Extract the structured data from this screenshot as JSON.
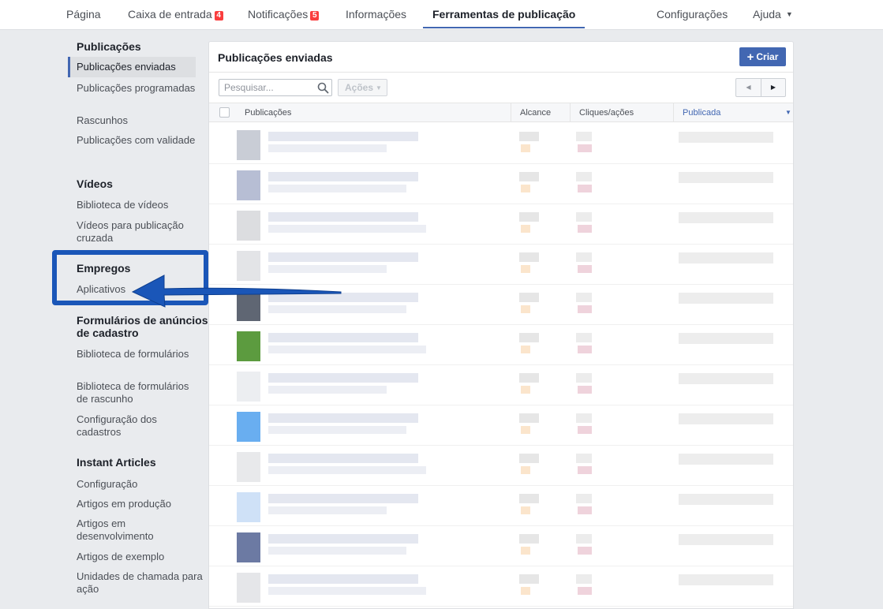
{
  "topnav": {
    "tabs": [
      {
        "label": "Página"
      },
      {
        "label": "Caixa de entrada",
        "badge": "4"
      },
      {
        "label": "Notificações",
        "badge": "5"
      },
      {
        "label": "Informações"
      },
      {
        "label": "Ferramentas de publicação",
        "active": true
      }
    ],
    "right": [
      {
        "label": "Configurações"
      },
      {
        "label": "Ajuda"
      }
    ]
  },
  "sidebar": {
    "sections": [
      {
        "title": "Publicações",
        "items": [
          {
            "label": "Publicações enviadas",
            "selected": true
          },
          {
            "label": "Publicações programadas"
          },
          {
            "label": "Rascunhos"
          },
          {
            "label": "Publicações com validade"
          }
        ]
      },
      {
        "title": "Vídeos",
        "items": [
          {
            "label": "Biblioteca de vídeos"
          },
          {
            "label": "Vídeos para publicação cruzada"
          }
        ]
      },
      {
        "title": "Empregos",
        "items": [
          {
            "label": "Aplicativos"
          }
        ]
      },
      {
        "title": "Formulários de anúncios de cadastro",
        "items": [
          {
            "label": "Biblioteca de formulários"
          },
          {
            "label": "Biblioteca de formulários de rascunho"
          },
          {
            "label": "Configuração dos cadastros"
          }
        ]
      },
      {
        "title": "Instant Articles",
        "items": [
          {
            "label": "Configuração"
          },
          {
            "label": "Artigos em produção"
          },
          {
            "label": "Artigos em desenvolvimento"
          },
          {
            "label": "Artigos de exemplo"
          },
          {
            "label": "Unidades de chamada para ação"
          }
        ]
      }
    ]
  },
  "main": {
    "title": "Publicações enviadas",
    "create_label": "Criar",
    "search_placeholder": "Pesquisar...",
    "actions_label": "Ações",
    "columns": [
      "Publicações",
      "Alcance",
      "Cliques/ações",
      "Publicada"
    ],
    "sorted_column": "Publicada",
    "row_count": 12
  },
  "colors": {
    "accent": "#4267b2",
    "badge": "#fa3e3e",
    "annotation": "#1a56b8"
  },
  "icons": [
    "search-icon",
    "plus-icon",
    "caret-down-icon",
    "chevron-left-icon",
    "chevron-right-icon",
    "arrow-annotation"
  ]
}
